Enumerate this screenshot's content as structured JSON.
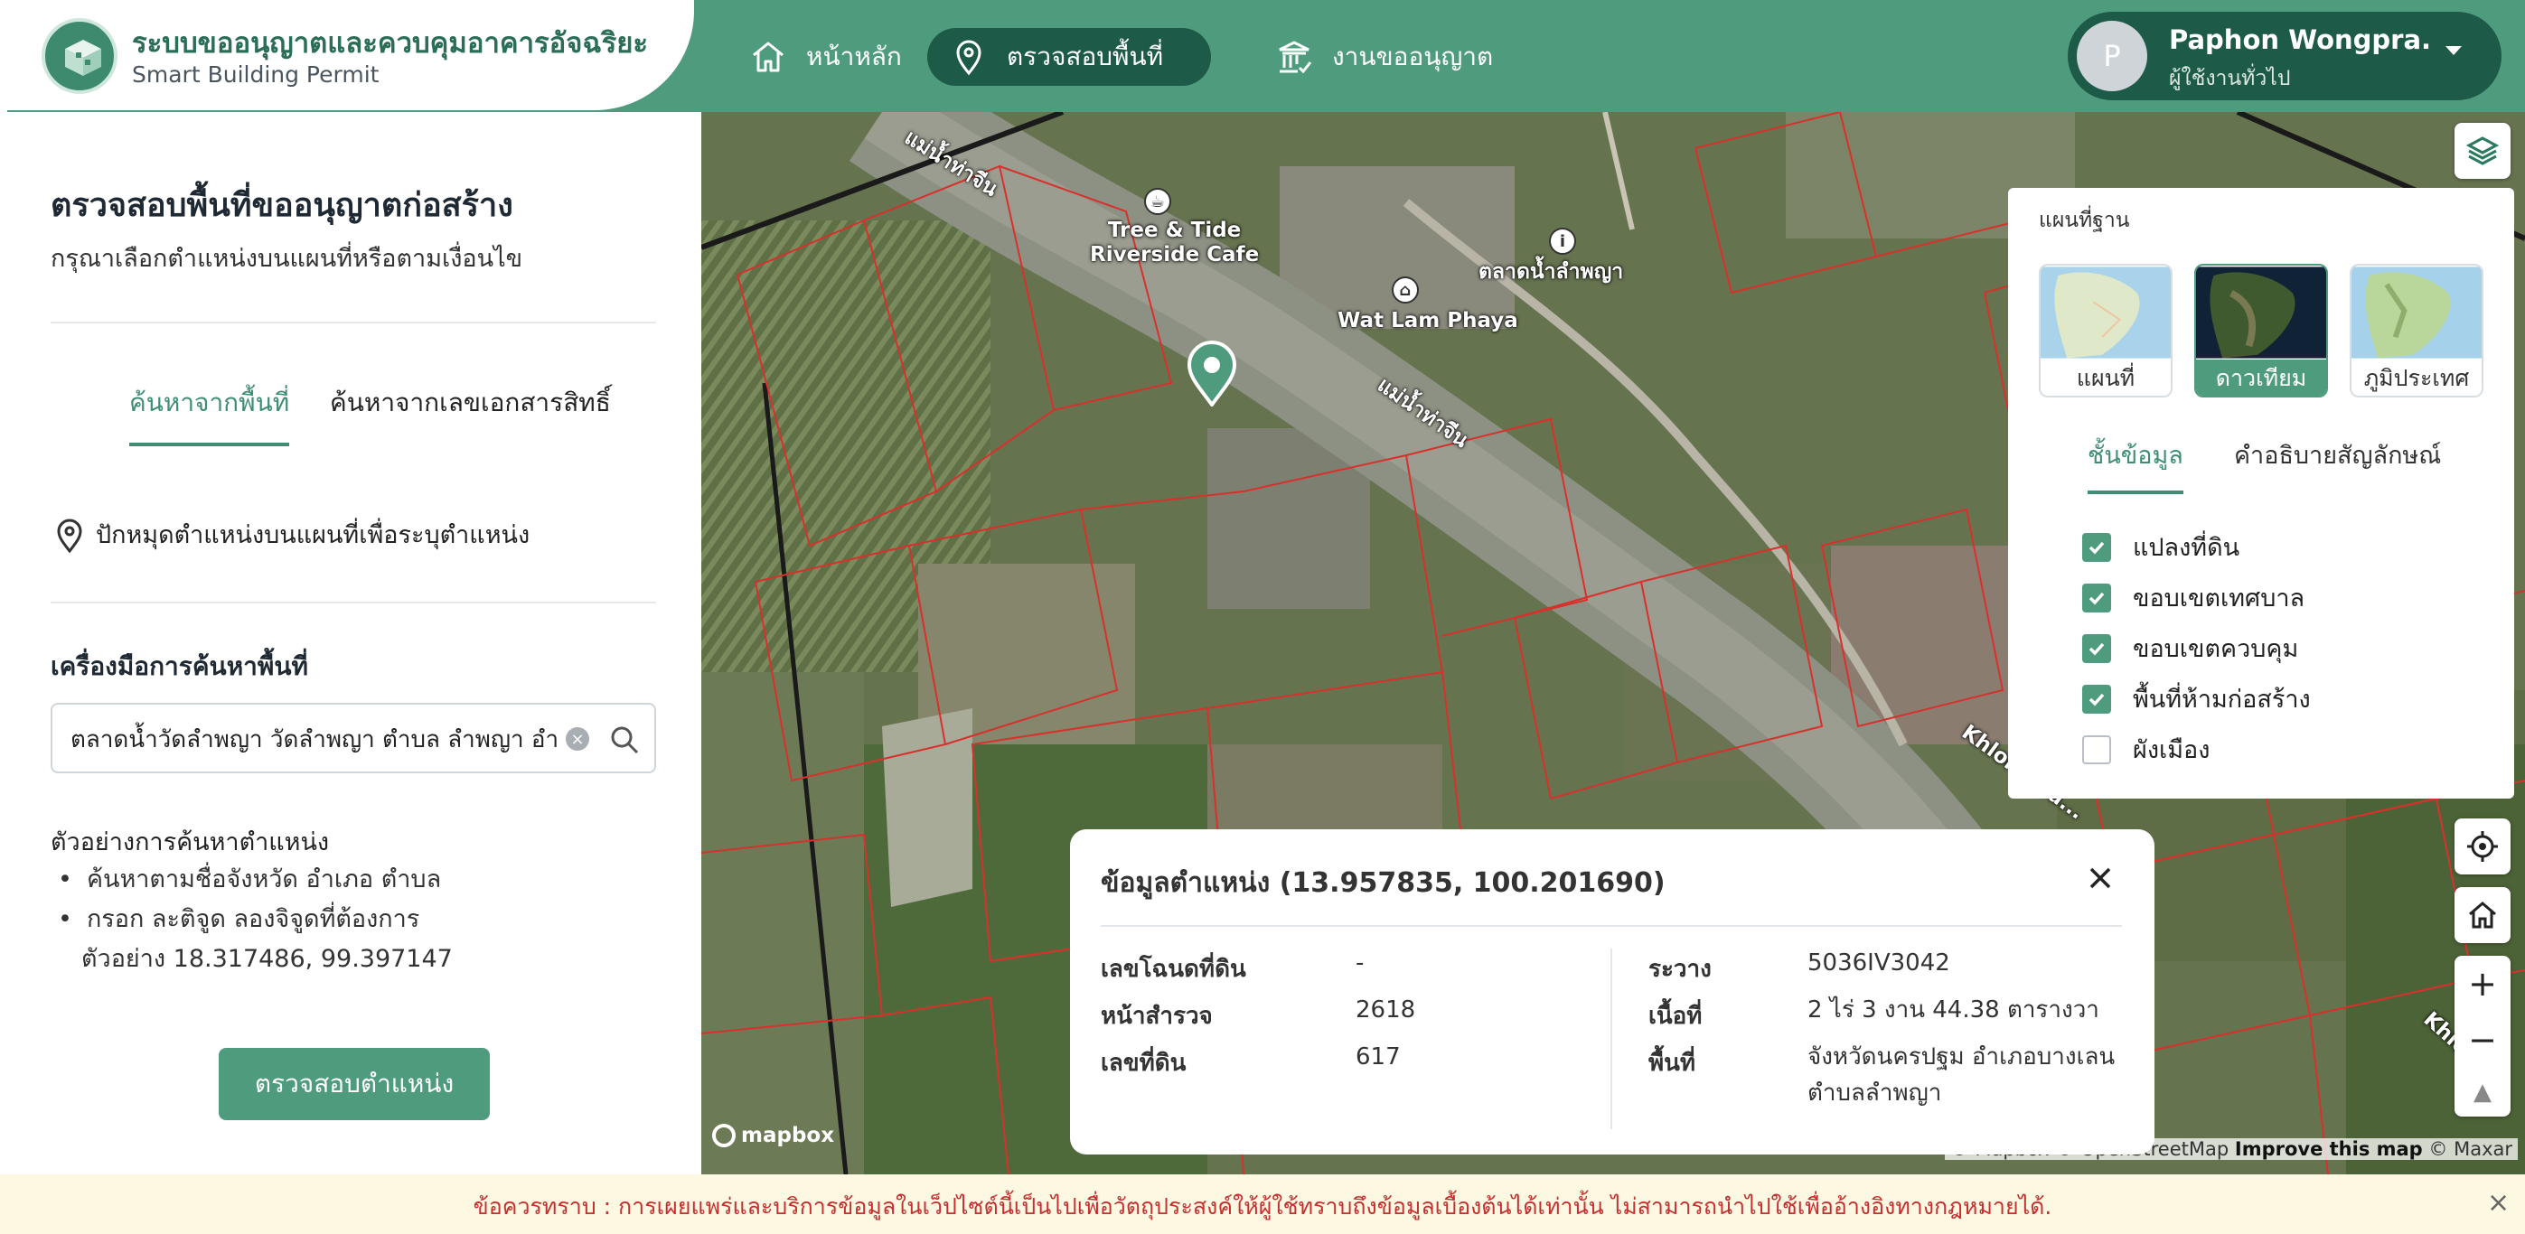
{
  "header": {
    "app_title": "ระบบขออนุญาตและควบคุมอาคารอัจฉริยะ",
    "app_subtitle": "Smart Building Permit",
    "nav": [
      {
        "label": "หน้าหลัก",
        "icon": "home-icon"
      },
      {
        "label": "ตรวจสอบพื้นที่",
        "icon": "map-pin-icon"
      },
      {
        "label": "งานขออนุญาต",
        "icon": "institution-icon"
      }
    ],
    "user": {
      "initial": "P",
      "name": "Paphon Wongpra...",
      "role": "ผู้ใช้งานทั่วไป"
    }
  },
  "sidebar": {
    "title": "ตรวจสอบพื้นที่ขออนุญาตก่อสร้าง",
    "subtitle": "กรุณาเลือกตำแหน่งบนแผนที่หรือตามเงื่อนไข",
    "tabs": [
      "ค้นหาจากพื้นที่",
      "ค้นหาจากเลขเอกสารสิทธิ์"
    ],
    "pin_hint": "ปักหมุดตำแหน่งบนแผนที่เพื่อระบุตำแหน่ง",
    "tools_title": "เครื่องมือการค้นหาพื้นที่",
    "search_value": "ตลาดน้ำวัดลำพญา วัดลำพญา ตำบล ลำพญา อำเภอบางเลน",
    "examples_title": "ตัวอย่างการค้นหาตำแหน่ง",
    "examples": [
      "ค้นหาตามชื่อจังหวัด อำเภอ ตำบล",
      "กรอก ละติจูด ลองจิจูดที่ต้องการ"
    ],
    "example_coord": "ตัวอย่าง 18.317486, 99.397147",
    "check_button": "ตรวจสอบตำแหน่ง"
  },
  "map": {
    "labels": {
      "river1": "แม่น้ำท่าจีน",
      "river2": "แม่น้ำท่าจีน",
      "cafe": "Tree & Tide\nRiverside Cafe",
      "temple": "Wat Lam Phaya",
      "market": "ตลาดน้ำลำพญา",
      "klong1": "Khlong Na...",
      "klong2": "Khlo..."
    },
    "logo": "mapbox",
    "attribution_prefix": "© Mapbox © OpenStreetMap",
    "attribution_improve": "Improve this map",
    "attribution_suffix": "© Maxar",
    "colors": {
      "parcel": "#d9302c",
      "river": "#8c9181",
      "field": "#6f7c55"
    }
  },
  "layers": {
    "basemap_title": "แผนที่ฐาน",
    "basemaps": [
      {
        "label": "แผนที่",
        "active": false
      },
      {
        "label": "ดาวเทียม",
        "active": true
      },
      {
        "label": "ภูมิประเทศ",
        "active": false
      }
    ],
    "tabs": [
      "ชั้นข้อมูล",
      "คำอธิบายสัญลักษณ์"
    ],
    "items": [
      {
        "label": "แปลงที่ดิน",
        "checked": true
      },
      {
        "label": "ขอบเขตเทศบาล",
        "checked": true
      },
      {
        "label": "ขอบเขตควบคุม",
        "checked": true
      },
      {
        "label": "พื้นที่ห้ามก่อสร้าง",
        "checked": true
      },
      {
        "label": "ผังเมือง",
        "checked": false
      }
    ]
  },
  "popup": {
    "title": "ข้อมูลตำแหน่ง (13.957835, 100.201690)",
    "left": [
      {
        "key": "เลขโฉนดที่ดิน",
        "value": "-"
      },
      {
        "key": "หน้าสำรวจ",
        "value": "2618"
      },
      {
        "key": "เลขที่ดิน",
        "value": "617"
      }
    ],
    "right": [
      {
        "key": "ระวาง",
        "value": "5036IV3042"
      },
      {
        "key": "เนื้อที่",
        "value": "2 ไร่ 3 งาน 44.38 ตารางวา"
      },
      {
        "key": "พื้นที่",
        "value": "จังหวัดนครปฐม อำเภอบางเลน\nตำบลลำพญา"
      }
    ]
  },
  "notice": {
    "text": "ข้อควรทราบ : การเผยแพร่และบริการข้อมูลในเว็ปไซต์นี้เป็นไปเพื่อวัตถุประสงค์ให้ผู้ใช้ทราบถึงข้อมูลเบื้องต้นได้เท่านั้น ไม่สามารถนำไปใช้เพื่ออ้างอิงทางกฎหมายได้.",
    "close": "×"
  }
}
